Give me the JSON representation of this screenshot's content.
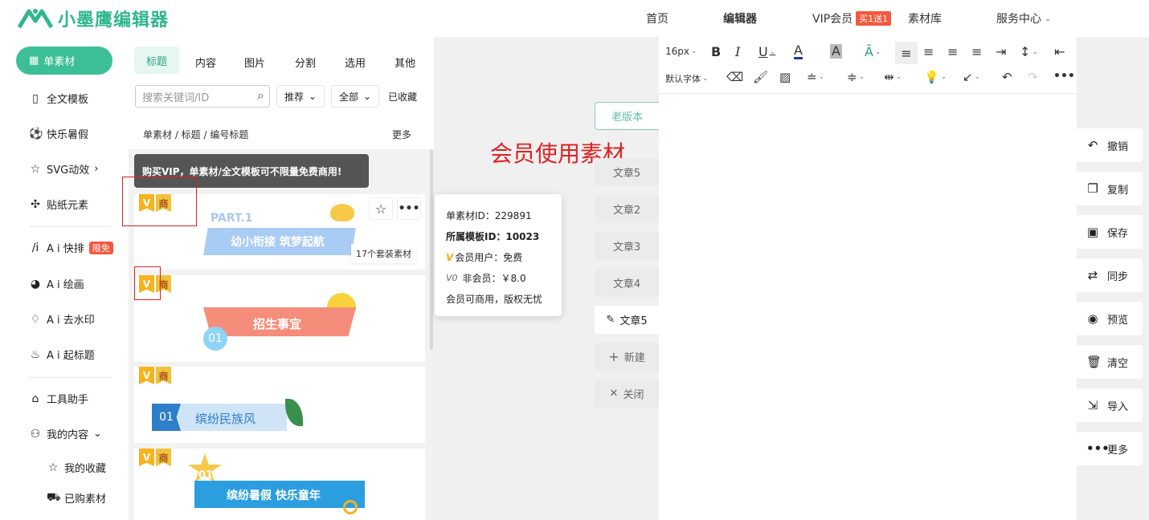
{
  "header": {
    "logo_text": "小墨鹰编辑器",
    "nav": {
      "home": "首页",
      "editor": "编辑器",
      "vip": "VIP会员",
      "vip_badge": "买1送1",
      "library": "素材库",
      "service": "服务中心"
    }
  },
  "left_nav": {
    "items": [
      {
        "label": "单素材",
        "icon": "grid-icon"
      },
      {
        "label": "全文模板",
        "icon": "template-icon"
      },
      {
        "label": "快乐暑假",
        "icon": "soccer-ball-icon"
      },
      {
        "label": "SVG动效",
        "icon": "star-outline-icon"
      },
      {
        "label": "贴纸元素",
        "icon": "puzzle-icon"
      },
      {
        "label": "A i 快排",
        "icon": "ai-icon",
        "badge": "限免"
      },
      {
        "label": "A i 绘画",
        "icon": "palette-icon"
      },
      {
        "label": "A i 去水印",
        "icon": "drop-icon"
      },
      {
        "label": "A i 起标题",
        "icon": "flame-icon"
      },
      {
        "label": "工具助手",
        "icon": "ruler-icon"
      },
      {
        "label": "我的内容",
        "icon": "user-icon"
      },
      {
        "label": "我的收藏",
        "icon": "star-icon"
      },
      {
        "label": "已购素材",
        "icon": "cart-icon"
      }
    ]
  },
  "panel": {
    "tabs": [
      "标题",
      "内容",
      "图片",
      "分割",
      "选用",
      "其他"
    ],
    "search_placeholder": "搜索关键词/ID",
    "filter_sort": "推荐",
    "filter_all": "全部",
    "collected": "已收藏",
    "breadcrumb": "单素材 / 标题 / 编号标题",
    "more": "更多",
    "tooltip": "购买VIP，单素材/全文模板可不限量免费商用!",
    "badge_v": "V",
    "badge_shang": "商",
    "cards": [
      {
        "part": "PART.1",
        "title": "幼小衔接 筑梦起航",
        "set_count": "17个套装素材"
      },
      {
        "number": "01",
        "title": "招生事宜"
      },
      {
        "number": "01",
        "title": "缤纷民族风"
      },
      {
        "number": "01",
        "title": "缤纷暑假 快乐童年"
      }
    ]
  },
  "popup": {
    "material_id": "单素材ID：229891",
    "template_id": "所属模板ID：10023",
    "member": "会员用户：免费",
    "non_member": "非会员：￥8.0",
    "note": "会员可商用，版权无忧",
    "v0": "V0"
  },
  "middle": {
    "old_version": "老版本",
    "annotation": "会员使用素材",
    "articles": [
      "文章5",
      "文章2",
      "文章3",
      "文章4",
      "文章5"
    ],
    "new": "新建",
    "close": "关闭"
  },
  "editor": {
    "font_size": "16px",
    "font_family": "默认字体"
  },
  "right_actions": [
    "撤销",
    "复制",
    "保存",
    "同步",
    "预览",
    "清空",
    "导入",
    "更多"
  ],
  "colors": {
    "brand": "#3cbf96",
    "annotation_red": "#e02020",
    "badge_red": "#f4583d"
  }
}
